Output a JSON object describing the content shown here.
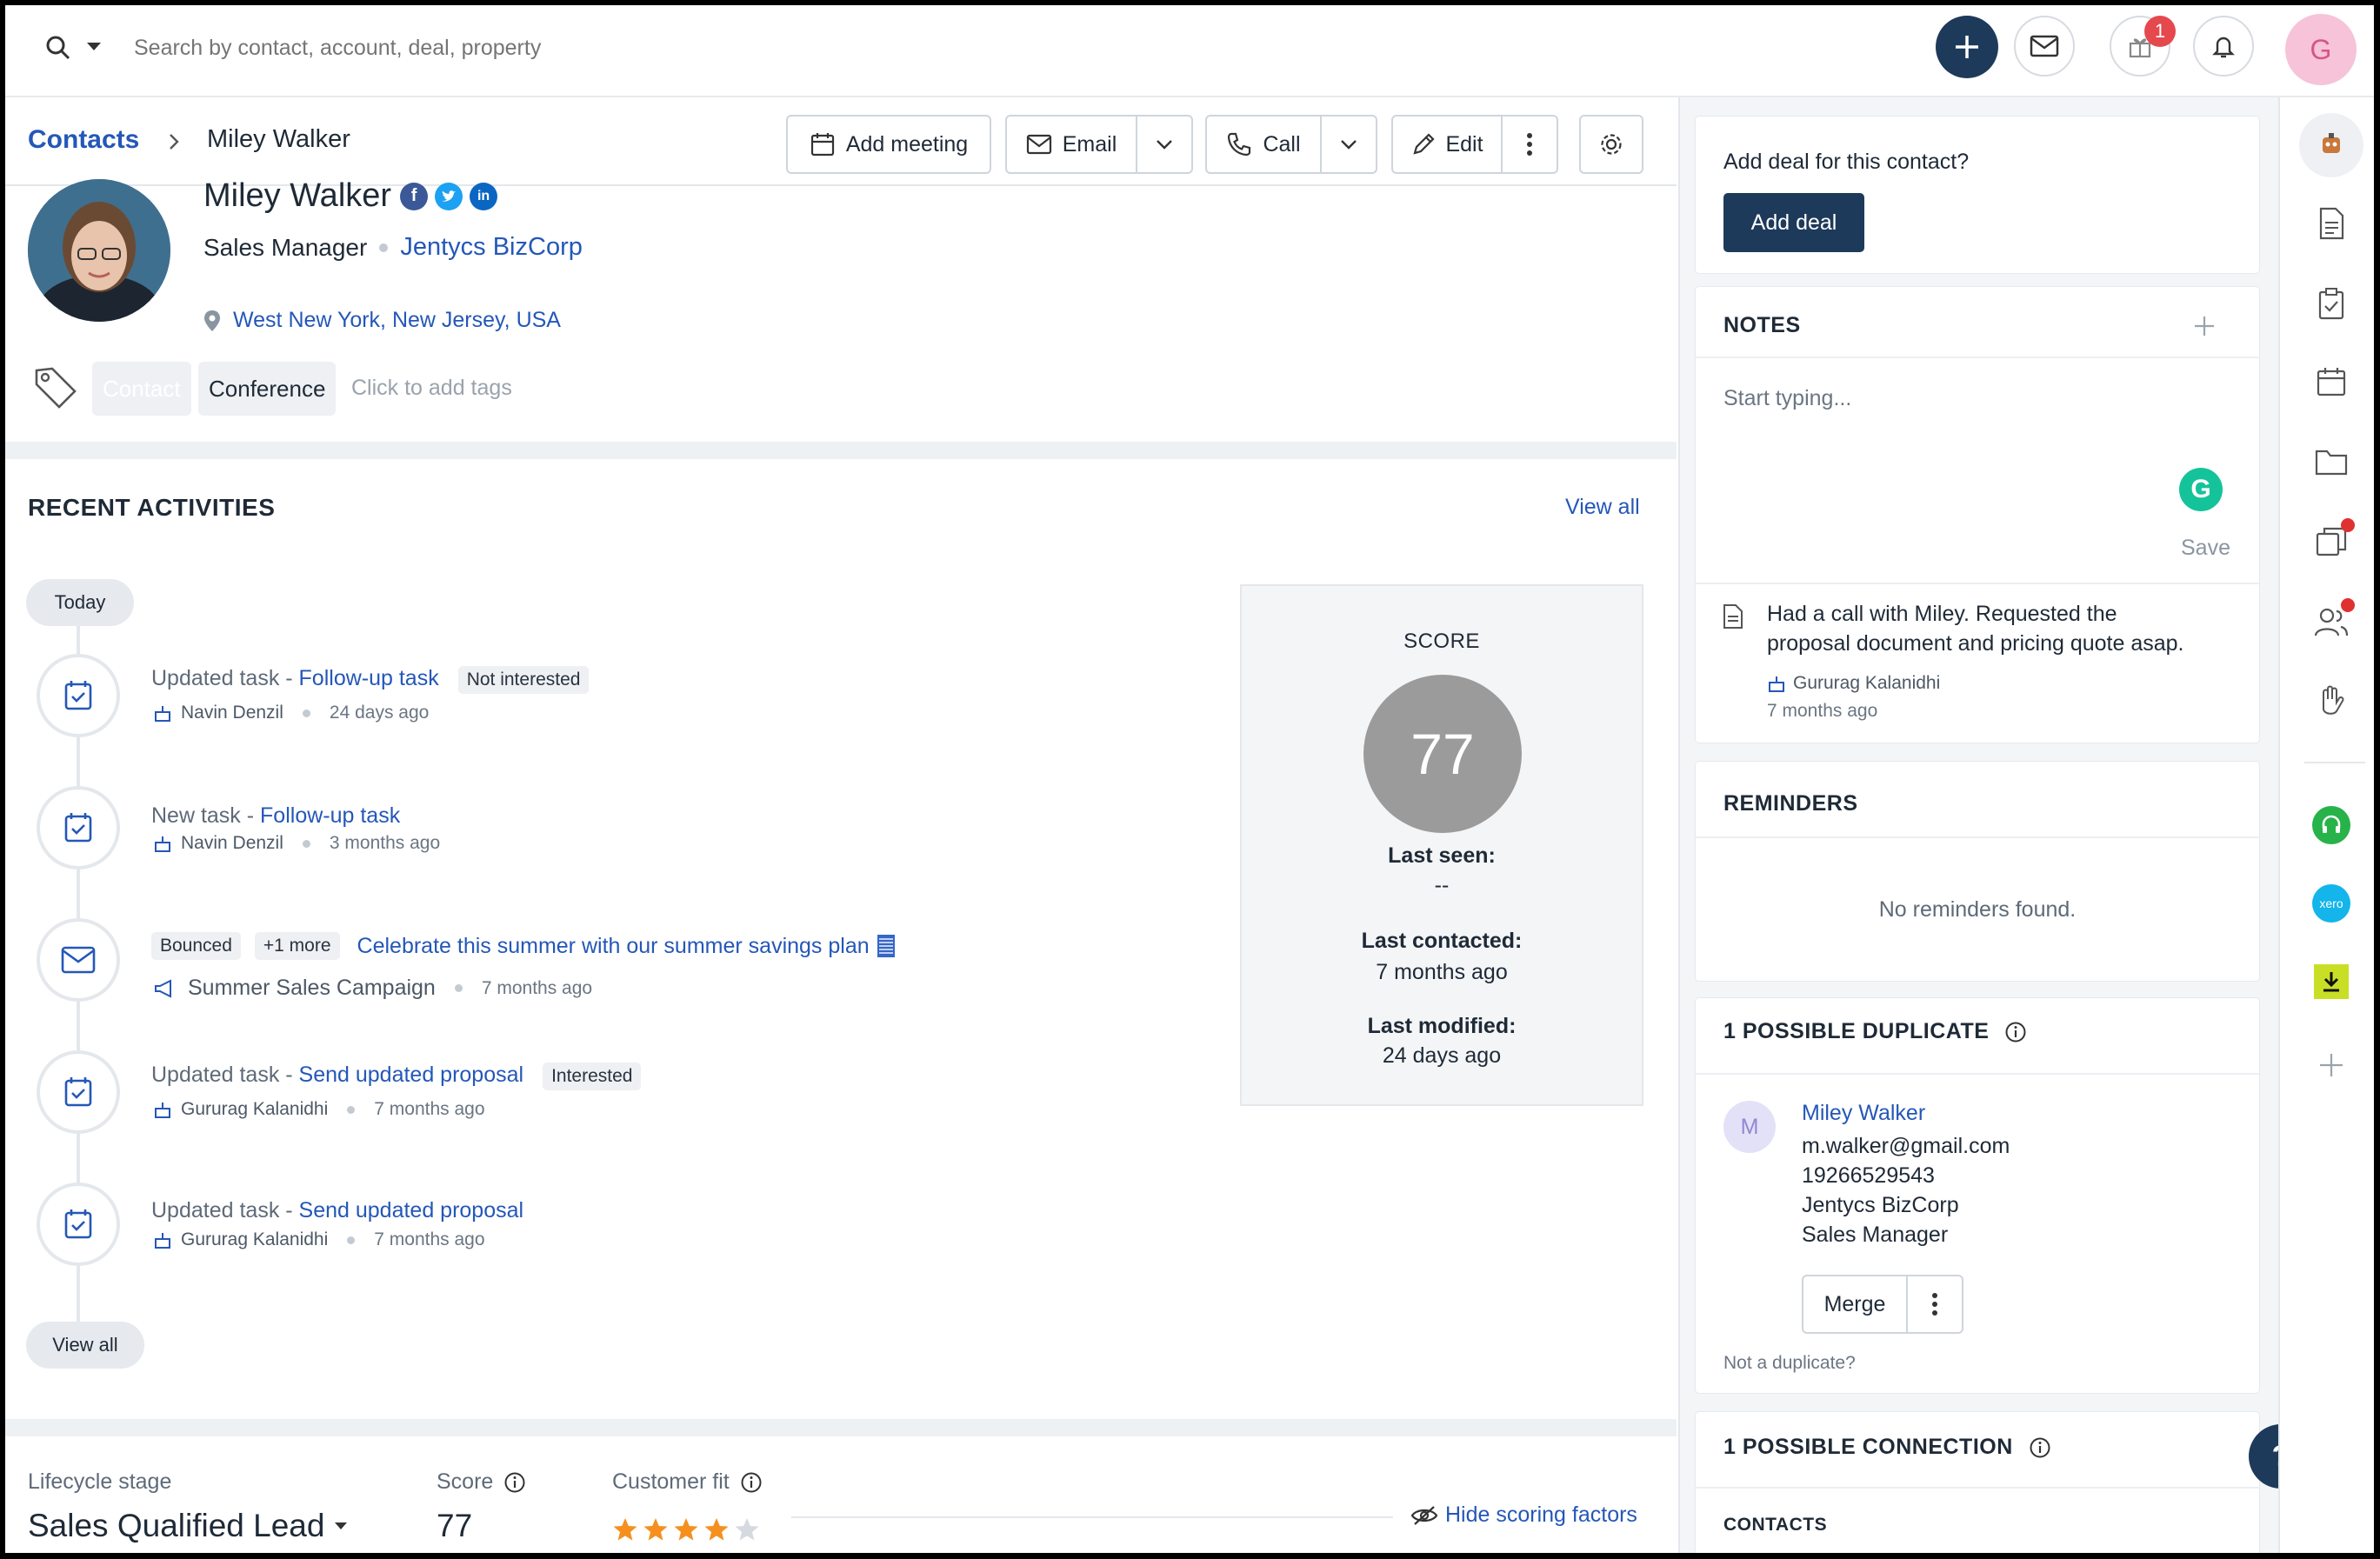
{
  "topbar": {
    "search_placeholder": "Search by contact, account, deal, property",
    "notification_count": "1",
    "avatar_initial": "G"
  },
  "breadcrumb": {
    "parent": "Contacts",
    "current": "Miley Walker"
  },
  "actions": {
    "add_meeting": "Add meeting",
    "email": "Email",
    "call": "Call",
    "edit": "Edit"
  },
  "contact": {
    "name": "Miley Walker",
    "job_title": "Sales Manager",
    "company": "Jentycs BizCorp",
    "location": "West New York, New Jersey, USA",
    "tags": [
      "Contact",
      "Conference"
    ],
    "add_tag_placeholder": "Click to add tags"
  },
  "activities": {
    "heading": "RECENT ACTIVITIES",
    "view_all": "View all",
    "group_label": "Today",
    "items": [
      {
        "prefix": "Updated task - ",
        "link": "Follow-up task",
        "badge": "Not interested",
        "user": "Navin Denzil",
        "time": "24 days ago"
      },
      {
        "prefix": "New task - ",
        "link": "Follow-up task",
        "badge": "",
        "user": "Navin Denzil",
        "time": "3 months ago"
      },
      {
        "badge1": "Bounced",
        "badge2": "+1 more",
        "link": "Celebrate this summer with our summer savings plan",
        "campaign": "Summer Sales Campaign",
        "time": "7 months ago"
      },
      {
        "prefix": "Updated task - ",
        "link": "Send updated proposal",
        "badge": "Interested",
        "user": "Gururag Kalanidhi",
        "time": "7 months ago"
      },
      {
        "prefix": "Updated task - ",
        "link": "Send updated proposal",
        "badge": "",
        "user": "Gururag Kalanidhi",
        "time": "7 months ago"
      }
    ],
    "view_all_bottom": "View all"
  },
  "score_card": {
    "title": "SCORE",
    "score": "77",
    "last_seen_label": "Last seen:",
    "last_seen_value": "--",
    "last_contacted_label": "Last contacted:",
    "last_contacted_value": "7 months ago",
    "last_modified_label": "Last modified:",
    "last_modified_value": "24 days ago"
  },
  "bottom": {
    "lifecycle_label": "Lifecycle stage",
    "lifecycle_value": "Sales Qualified Lead",
    "score_label": "Score",
    "score_value": "77",
    "fit_label": "Customer fit",
    "fit_rating": 4,
    "fit_max": 5,
    "hide_scoring": "Hide scoring factors"
  },
  "right": {
    "deal_prompt": "Add deal for this contact?",
    "add_deal": "Add deal",
    "notes_heading": "NOTES",
    "notes_placeholder": "Start typing...",
    "save": "Save",
    "note_text_line1": "Had a call with Miley. Requested the",
    "note_text_line2": "proposal document and pricing quote asap.",
    "note_author": "Gururag Kalanidhi",
    "note_time": "7 months ago",
    "reminders_heading": "REMINDERS",
    "reminders_empty": "No reminders found.",
    "duplicate_heading": "1 POSSIBLE DUPLICATE",
    "dup_initial": "M",
    "dup_name": "Miley Walker",
    "dup_email": "m.walker@gmail.com",
    "dup_phone": "19266529543",
    "dup_company": "Jentycs BizCorp",
    "dup_title": "Sales Manager",
    "merge": "Merge",
    "not_duplicate": "Not a duplicate?",
    "connection_heading": "1 POSSIBLE CONNECTION",
    "contacts_sub": "CONTACTS"
  },
  "colors": {
    "brand_dark": "#1e3a5a",
    "link": "#2457b8",
    "score_circle": "#9b9b9b",
    "star": "#f5901e",
    "badge_red": "#e5484d"
  },
  "help_icon": "?"
}
